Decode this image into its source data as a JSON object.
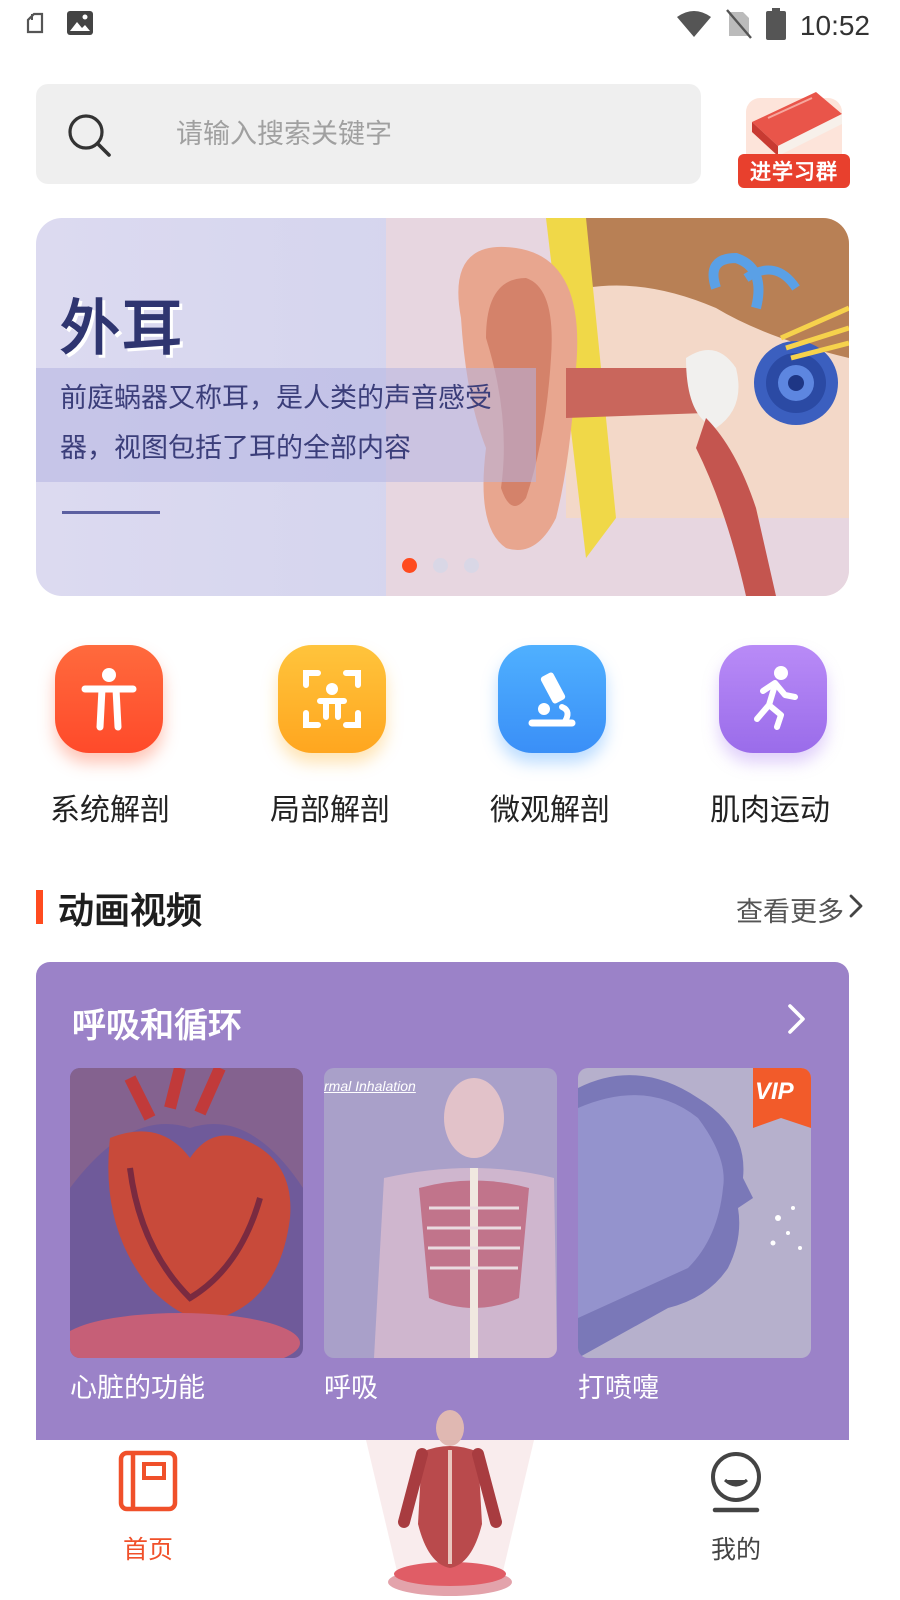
{
  "status_bar": {
    "time": "10:52",
    "icons": [
      "notification-icon",
      "image-icon",
      "wifi-icon",
      "no-sim-icon",
      "battery-icon"
    ]
  },
  "search": {
    "placeholder": "请输入搜索关键字"
  },
  "study_group": {
    "label": "进学习群"
  },
  "banner": {
    "title": "外耳",
    "description": "前庭蜗器又称耳，是人类的声音感受器，视图包括了耳的全部内容",
    "page_count": 3,
    "active_page": 1
  },
  "categories": [
    {
      "label": "系统解剖",
      "icon": "person-icon",
      "color": "#ff5a2e"
    },
    {
      "label": "局部解剖",
      "icon": "scan-person-icon",
      "color": "#ffb228"
    },
    {
      "label": "微观解剖",
      "icon": "microscope-icon",
      "color": "#3d9cff"
    },
    {
      "label": "肌肉运动",
      "icon": "running-icon",
      "color": "#a779f2"
    }
  ],
  "section": {
    "title": "动画视频",
    "more": "查看更多"
  },
  "video_group": {
    "title": "呼吸和循环",
    "videos": [
      {
        "label": "心脏的功能",
        "vip": false
      },
      {
        "label": "呼吸",
        "overlay_text": "rmal Inhalation",
        "vip": false
      },
      {
        "label": "打喷嚏",
        "vip": true,
        "badge": "VIP"
      }
    ]
  },
  "bottom_nav": {
    "home": "首页",
    "mine": "我的"
  },
  "colors": {
    "accent": "#ff4b1f",
    "card_purple": "#9b82c8",
    "banner_text": "#2f3570"
  }
}
